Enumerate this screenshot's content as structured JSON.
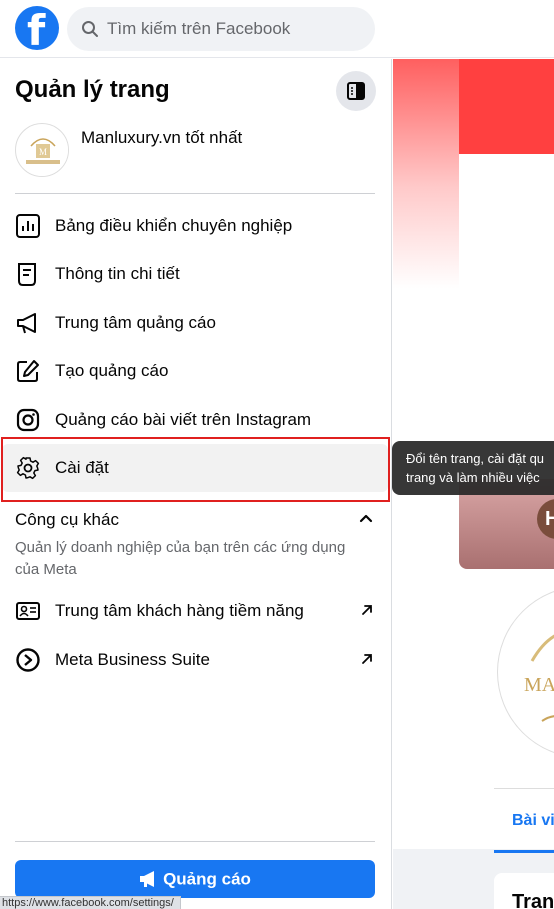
{
  "topbar": {
    "logo": "facebook-logo",
    "search_placeholder": "Tìm kiếm trên Facebook"
  },
  "panel": {
    "title": "Quản lý trang",
    "page_name": "Manluxury.vn tốt nhất",
    "menu": [
      {
        "label": "Bảng điều khiển chuyên nghiệp",
        "icon": "dashboard-icon"
      },
      {
        "label": "Thông tin chi tiết",
        "icon": "insights-icon"
      },
      {
        "label": "Trung tâm quảng cáo",
        "icon": "megaphone-icon"
      },
      {
        "label": "Tạo quảng cáo",
        "icon": "pencil-icon"
      },
      {
        "label": "Quảng cáo bài viết trên Instagram",
        "icon": "instagram-icon"
      },
      {
        "label": "Cài đặt",
        "icon": "gear-icon"
      }
    ],
    "other_tools": {
      "title": "Công cụ khác",
      "description": "Quản lý doanh nghiệp của bạn trên các ứng dụng của Meta",
      "items": [
        {
          "label": "Trung tâm khách hàng tiềm năng",
          "icon": "lead-center-icon"
        },
        {
          "label": "Meta Business Suite",
          "icon": "meta-business-icon"
        }
      ]
    },
    "ad_button": "Quảng cáo"
  },
  "tooltip": {
    "line1": "Đổi tên trang, cài đặt qu",
    "line2": "trang và làm nhiều việc"
  },
  "right": {
    "cover_letter": "H",
    "tab_label": "Bài viế",
    "card_title": "Tran"
  },
  "status_url": "https://www.facebook.com/settings/",
  "colors": {
    "brand_blue": "#1877f2",
    "highlight_red": "#e0201f"
  }
}
